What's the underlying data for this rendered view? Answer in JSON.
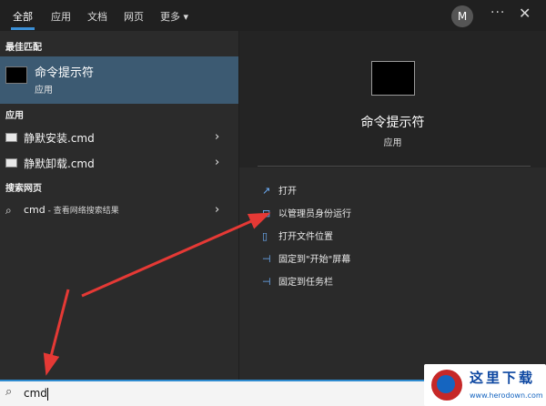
{
  "topbar": {
    "tabs": [
      "全部",
      "应用",
      "文档",
      "网页",
      "更多"
    ],
    "more_chevron": "▾",
    "avatar": "M",
    "dots": "···",
    "close": "✕"
  },
  "left": {
    "best_match_heading": "最佳匹配",
    "best_match": {
      "title": "命令提示符",
      "subtitle": "应用",
      "icon": "terminal-icon"
    },
    "apps_heading": "应用",
    "apps": [
      {
        "label": "静默安装.cmd",
        "icon": "cmd-file-icon"
      },
      {
        "label": "静默卸载.cmd",
        "icon": "cmd-file-icon"
      }
    ],
    "web_heading": "搜索网页",
    "web": {
      "query": "cmd",
      "hint": " - 查看网络搜索结果",
      "icon": "search-icon"
    },
    "chevron": "›"
  },
  "right": {
    "title": "命令提示符",
    "subtitle": "应用",
    "actions": [
      {
        "label": "打开",
        "icon": "open-icon",
        "glyph": "↗"
      },
      {
        "label": "以管理员身份运行",
        "icon": "run-as-admin-icon",
        "glyph": "⊡"
      },
      {
        "label": "打开文件位置",
        "icon": "file-location-icon",
        "glyph": "▯"
      },
      {
        "label": "固定到\"开始\"屏幕",
        "icon": "pin-start-icon",
        "glyph": "⊣"
      },
      {
        "label": "固定到任务栏",
        "icon": "pin-taskbar-icon",
        "glyph": "⊣"
      }
    ]
  },
  "search": {
    "value": "cmd",
    "icon": "search-icon"
  },
  "watermark": {
    "text": "这里下载",
    "url": "www.herodown.com"
  },
  "colors": {
    "accent": "#3b8fd6",
    "selected": "#3c5a72",
    "arrow": "#e53935"
  }
}
